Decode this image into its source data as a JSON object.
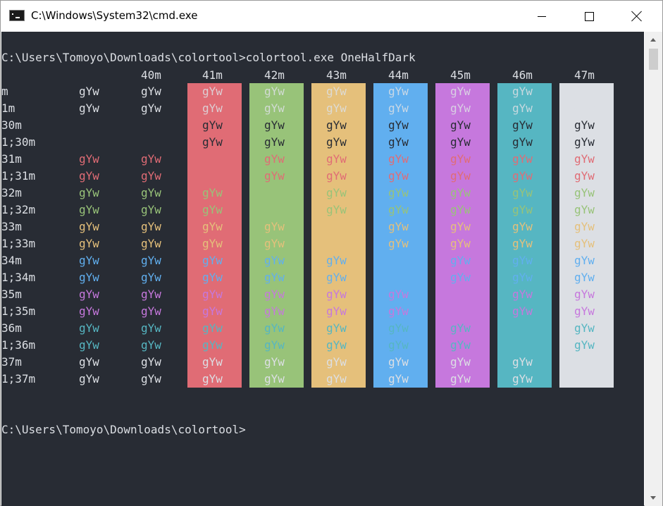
{
  "window": {
    "title": "C:\\Windows\\System32\\cmd.exe",
    "icons": {
      "app": "console-app-icon",
      "minimize": "minimize-icon",
      "maximize": "maximize-icon",
      "close": "close-icon"
    }
  },
  "console": {
    "command_line": "C:\\Users\\Tomoyo\\Downloads\\colortool>colortool.exe OneHalfDark",
    "prompt": "C:\\Users\\Tomoyo\\Downloads\\colortool>",
    "sample_text": "gYw",
    "bg_headers": [
      "40m",
      "41m",
      "42m",
      "43m",
      "44m",
      "45m",
      "46m",
      "47m"
    ],
    "fg_rows": [
      "m",
      "1m",
      "30m",
      "1;30m",
      "31m",
      "1;31m",
      "32m",
      "1;32m",
      "33m",
      "1;33m",
      "34m",
      "1;34m",
      "35m",
      "1;35m",
      "36m",
      "1;36m",
      "37m",
      "1;37m"
    ],
    "colors": {
      "default_bg": "#282c34",
      "default_fg": "#dcdfe4",
      "black": "#282c34",
      "red": "#e06c75",
      "green": "#98c379",
      "yellow": "#e5c07b",
      "blue": "#61afef",
      "magenta": "#c678dd",
      "cyan": "#56b6c2",
      "white": "#dcdfe4"
    }
  },
  "scrollbar": {
    "up_icon": "scroll-up-arrow-icon",
    "down_icon": "scroll-down-arrow-icon",
    "thumb_position": 0
  }
}
